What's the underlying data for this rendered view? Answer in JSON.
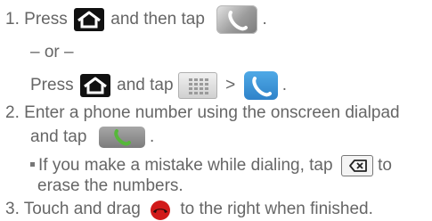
{
  "step1": {
    "number": "1.",
    "press": "Press",
    "then_tap": "and then tap",
    "period": ".",
    "or": "– or –",
    "press2": "Press",
    "and_tap": "and tap",
    "gt": ">",
    "period2": "."
  },
  "step2": {
    "number": "2.",
    "line1": "Enter a phone number using the onscreen dialpad",
    "line2": "and tap",
    "period": ".",
    "bullet_line1": "If you make a mistake while dialing, tap",
    "bullet_to": "to",
    "bullet_line2": "erase the numbers."
  },
  "step3": {
    "number": "3.",
    "touch": "Touch and drag",
    "rest": "to the right when finished."
  },
  "colors": {
    "text": "#666666",
    "phone_blue": "#2f82c9",
    "phone_green": "#56b83a",
    "end_call_red": "#d11a1a"
  }
}
